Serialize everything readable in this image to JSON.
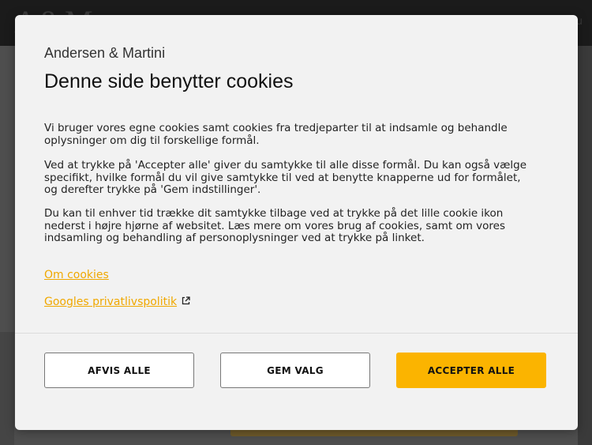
{
  "background": {
    "logo_text": "A&M",
    "menu_text": "u"
  },
  "modal": {
    "brand": "Andersen & Martini",
    "title": "Denne side benytter cookies",
    "paragraphs": [
      "Vi bruger vores egne cookies samt cookies fra tredjeparter til at indsamle og behandle oplysninger om dig til forskellige formål.",
      "Ved at trykke på 'Accepter alle' giver du samtykke til alle disse formål. Du kan også vælge specifikt, hvilke formål du vil give samtykke til ved at benytte knapperne ud for formålet, og derefter trykke på 'Gem indstillinger'.",
      "Du kan til enhver tid trække dit samtykke tilbage ved at trykke på det lille cookie ikon nederst i højre hjørne af websitet. Læs mere om vores brug af cookies, samt om vores indsamling og behandling af personoplysninger ved at trykke på linket."
    ],
    "links": {
      "about_cookies": "Om cookies",
      "google_privacy": "Googles privatlivspolitik",
      "google_privacy_icon": "external-link-icon"
    },
    "buttons": {
      "reject_all": "AFVIS ALLE",
      "save_choice": "GEM VALG",
      "accept_all": "ACCEPTER ALLE"
    }
  },
  "colors": {
    "accent": "#fbb400",
    "link": "#f0a800",
    "modal_bg": "#f2f2f2",
    "overlay": "#5a5a5a"
  }
}
